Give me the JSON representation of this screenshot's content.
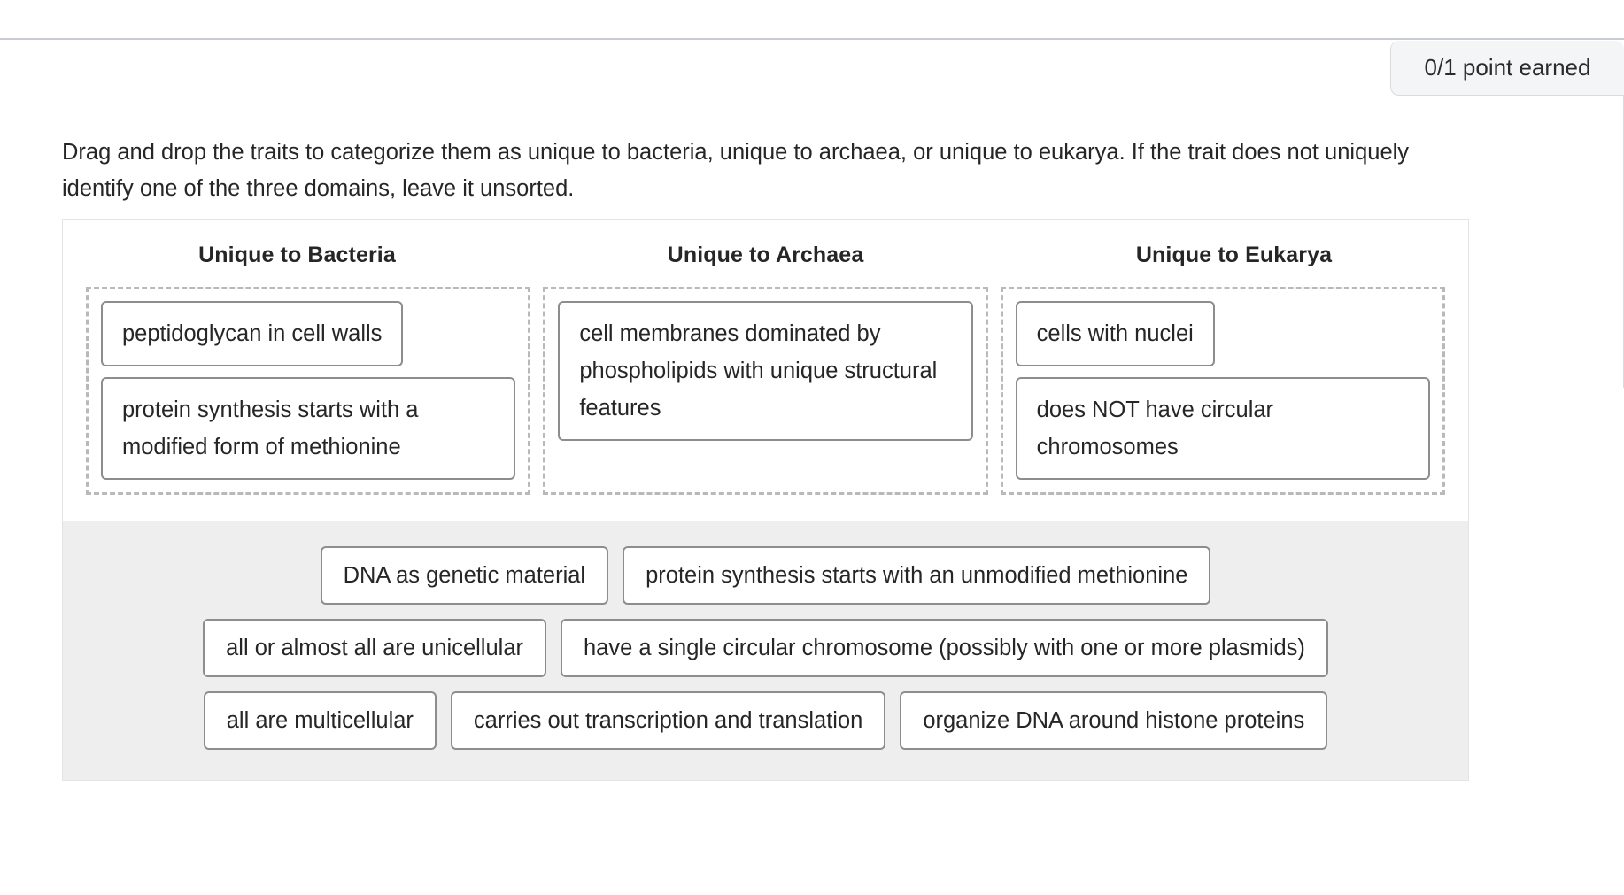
{
  "score_badge": {
    "label": "0/1 point earned"
  },
  "instructions": {
    "text": "Drag and drop the traits to categorize them as unique to bacteria, unique to archaea, or unique to eukarya. If the trait does not uniquely identify one of the three domains, leave it unsorted."
  },
  "columns": [
    {
      "header": "Unique to Bacteria",
      "items": [
        "peptidoglycan in cell walls",
        "protein synthesis starts with a modified form of methionine"
      ]
    },
    {
      "header": "Unique to Archaea",
      "items": [
        "cell membranes dominated by phospholipids with unique structural features"
      ]
    },
    {
      "header": "Unique to Eukarya",
      "items": [
        "cells with nuclei",
        "does NOT have circular chromosomes"
      ]
    }
  ],
  "unsorted_bank": {
    "rows": [
      [
        "DNA as genetic material",
        "protein synthesis starts with an unmodified methionine"
      ],
      [
        "all or almost all are unicellular",
        "have a single circular chromosome (possibly with one or more plasmids)"
      ],
      [
        "all are multicellular",
        "carries out transcription and translation",
        "organize DNA around histone proteins"
      ]
    ]
  },
  "colors": {
    "badge_background": "#f4f5f7",
    "bank_background": "#eeeeee",
    "chip_border": "#8d8d8d",
    "dropzone_border": "#b9b9b9",
    "text": "#262626"
  }
}
